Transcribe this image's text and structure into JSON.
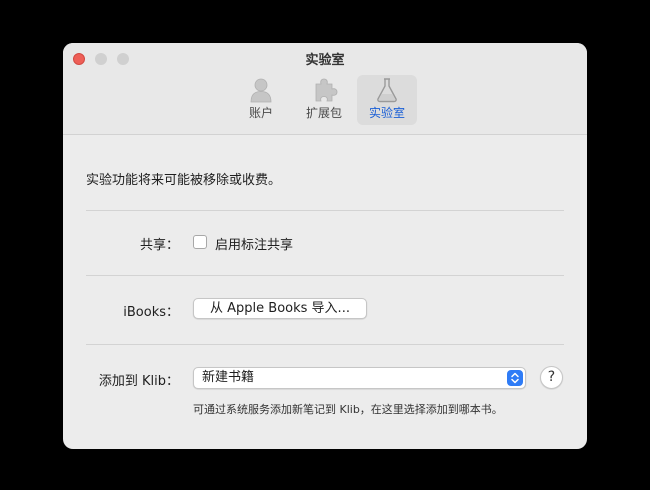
{
  "window": {
    "title": "实验室"
  },
  "toolbar": {
    "tabs": [
      {
        "label": "账户",
        "icon": "person-icon"
      },
      {
        "label": "扩展包",
        "icon": "puzzle-icon"
      },
      {
        "label": "实验室",
        "icon": "flask-icon",
        "active": true
      }
    ]
  },
  "content": {
    "intro": "实验功能将来可能被移除或收费。",
    "share": {
      "label": "共享：",
      "checkbox_label": "启用标注共享",
      "checked": false
    },
    "ibooks": {
      "label": "iBooks：",
      "button_label": "从 Apple Books 导入..."
    },
    "klib": {
      "label": "添加到 Klib：",
      "selected": "新建书籍",
      "help": "?",
      "hint": "可通过系统服务添加新笔记到 Klib，在这里选择添加到哪本书。"
    }
  },
  "colors": {
    "accent": "#2f7cf6",
    "active_tab_text": "#1a5fd6",
    "close": "#ee5f57"
  }
}
